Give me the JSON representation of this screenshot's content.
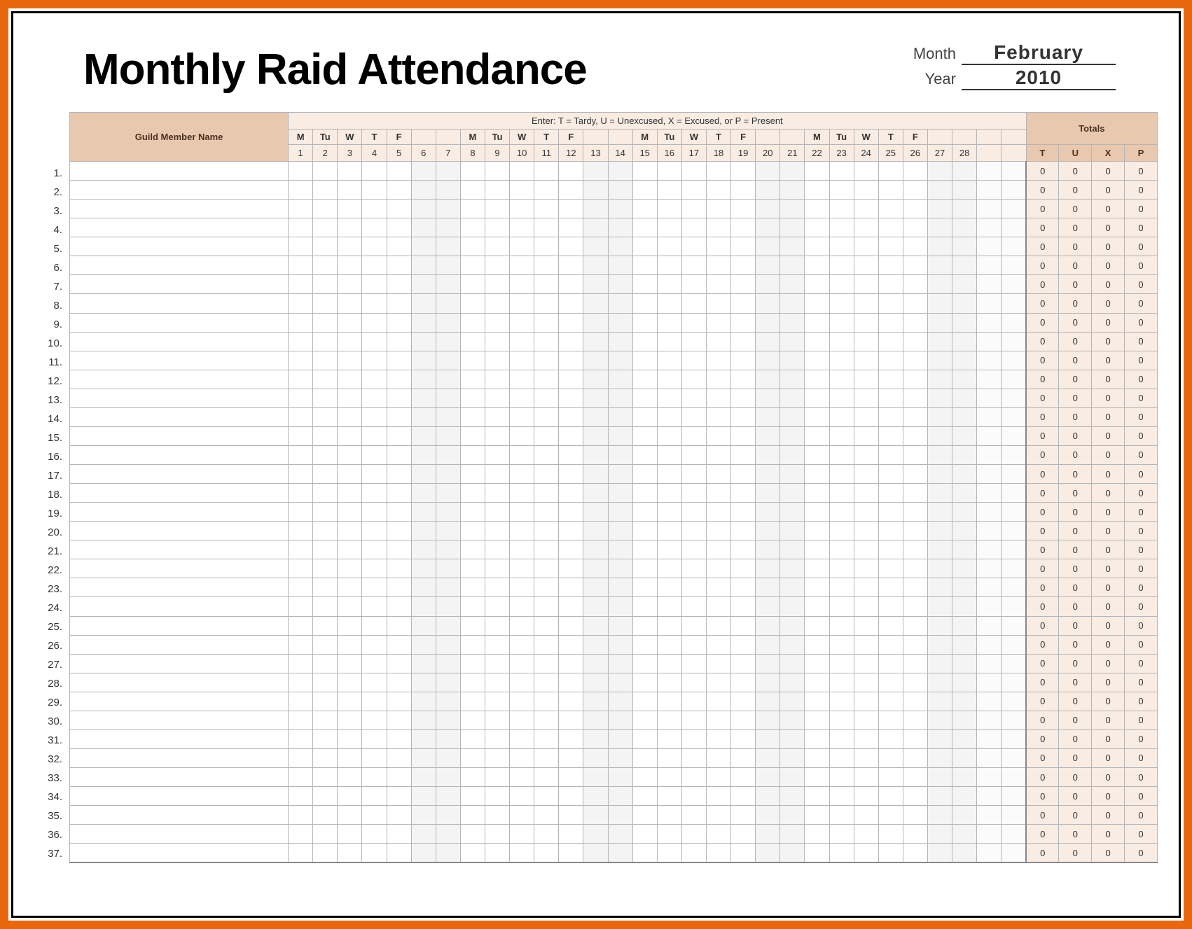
{
  "title": "Monthly Raid Attendance",
  "month_label": "Month",
  "year_label": "Year",
  "month_value": "February",
  "year_value": "2010",
  "name_header": "Guild Member Name",
  "legend": "Enter: T = Tardy,  U = Unexcused,  X = Excused,  or P = Present",
  "totals_header": "Totals",
  "total_codes": [
    "T",
    "U",
    "X",
    "P"
  ],
  "days": [
    {
      "n": 1,
      "dow": "M",
      "weekend": false
    },
    {
      "n": 2,
      "dow": "Tu",
      "weekend": false
    },
    {
      "n": 3,
      "dow": "W",
      "weekend": false
    },
    {
      "n": 4,
      "dow": "T",
      "weekend": false
    },
    {
      "n": 5,
      "dow": "F",
      "weekend": false
    },
    {
      "n": 6,
      "dow": "",
      "weekend": true
    },
    {
      "n": 7,
      "dow": "",
      "weekend": true
    },
    {
      "n": 8,
      "dow": "M",
      "weekend": false
    },
    {
      "n": 9,
      "dow": "Tu",
      "weekend": false
    },
    {
      "n": 10,
      "dow": "W",
      "weekend": false
    },
    {
      "n": 11,
      "dow": "T",
      "weekend": false
    },
    {
      "n": 12,
      "dow": "F",
      "weekend": false
    },
    {
      "n": 13,
      "dow": "",
      "weekend": true
    },
    {
      "n": 14,
      "dow": "",
      "weekend": true
    },
    {
      "n": 15,
      "dow": "M",
      "weekend": false
    },
    {
      "n": 16,
      "dow": "Tu",
      "weekend": false
    },
    {
      "n": 17,
      "dow": "W",
      "weekend": false
    },
    {
      "n": 18,
      "dow": "T",
      "weekend": false
    },
    {
      "n": 19,
      "dow": "F",
      "weekend": false
    },
    {
      "n": 20,
      "dow": "",
      "weekend": true
    },
    {
      "n": 21,
      "dow": "",
      "weekend": true
    },
    {
      "n": 22,
      "dow": "M",
      "weekend": false
    },
    {
      "n": 23,
      "dow": "Tu",
      "weekend": false
    },
    {
      "n": 24,
      "dow": "W",
      "weekend": false
    },
    {
      "n": 25,
      "dow": "T",
      "weekend": false
    },
    {
      "n": 26,
      "dow": "F",
      "weekend": false
    },
    {
      "n": 27,
      "dow": "",
      "weekend": true
    },
    {
      "n": 28,
      "dow": "",
      "weekend": true
    }
  ],
  "overflow_cols": 2,
  "rows": [
    {
      "num": "1.",
      "name": "",
      "marks": [],
      "totals": [
        0,
        0,
        0,
        0
      ]
    },
    {
      "num": "2.",
      "name": "",
      "marks": [],
      "totals": [
        0,
        0,
        0,
        0
      ]
    },
    {
      "num": "3.",
      "name": "",
      "marks": [],
      "totals": [
        0,
        0,
        0,
        0
      ]
    },
    {
      "num": "4.",
      "name": "",
      "marks": [],
      "totals": [
        0,
        0,
        0,
        0
      ]
    },
    {
      "num": "5.",
      "name": "",
      "marks": [],
      "totals": [
        0,
        0,
        0,
        0
      ]
    },
    {
      "num": "6.",
      "name": "",
      "marks": [],
      "totals": [
        0,
        0,
        0,
        0
      ]
    },
    {
      "num": "7.",
      "name": "",
      "marks": [],
      "totals": [
        0,
        0,
        0,
        0
      ]
    },
    {
      "num": "8.",
      "name": "",
      "marks": [],
      "totals": [
        0,
        0,
        0,
        0
      ]
    },
    {
      "num": "9.",
      "name": "",
      "marks": [],
      "totals": [
        0,
        0,
        0,
        0
      ]
    },
    {
      "num": "10.",
      "name": "",
      "marks": [],
      "totals": [
        0,
        0,
        0,
        0
      ]
    },
    {
      "num": "11.",
      "name": "",
      "marks": [],
      "totals": [
        0,
        0,
        0,
        0
      ]
    },
    {
      "num": "12.",
      "name": "",
      "marks": [],
      "totals": [
        0,
        0,
        0,
        0
      ]
    },
    {
      "num": "13.",
      "name": "",
      "marks": [],
      "totals": [
        0,
        0,
        0,
        0
      ]
    },
    {
      "num": "14.",
      "name": "",
      "marks": [],
      "totals": [
        0,
        0,
        0,
        0
      ]
    },
    {
      "num": "15.",
      "name": "",
      "marks": [],
      "totals": [
        0,
        0,
        0,
        0
      ]
    },
    {
      "num": "16.",
      "name": "",
      "marks": [],
      "totals": [
        0,
        0,
        0,
        0
      ]
    },
    {
      "num": "17.",
      "name": "",
      "marks": [],
      "totals": [
        0,
        0,
        0,
        0
      ]
    },
    {
      "num": "18.",
      "name": "",
      "marks": [],
      "totals": [
        0,
        0,
        0,
        0
      ]
    },
    {
      "num": "19.",
      "name": "",
      "marks": [],
      "totals": [
        0,
        0,
        0,
        0
      ]
    },
    {
      "num": "20.",
      "name": "",
      "marks": [],
      "totals": [
        0,
        0,
        0,
        0
      ]
    },
    {
      "num": "21.",
      "name": "",
      "marks": [],
      "totals": [
        0,
        0,
        0,
        0
      ]
    },
    {
      "num": "22.",
      "name": "",
      "marks": [],
      "totals": [
        0,
        0,
        0,
        0
      ]
    },
    {
      "num": "23.",
      "name": "",
      "marks": [],
      "totals": [
        0,
        0,
        0,
        0
      ]
    },
    {
      "num": "24.",
      "name": "",
      "marks": [],
      "totals": [
        0,
        0,
        0,
        0
      ]
    },
    {
      "num": "25.",
      "name": "",
      "marks": [],
      "totals": [
        0,
        0,
        0,
        0
      ]
    },
    {
      "num": "26.",
      "name": "",
      "marks": [],
      "totals": [
        0,
        0,
        0,
        0
      ]
    },
    {
      "num": "27.",
      "name": "",
      "marks": [],
      "totals": [
        0,
        0,
        0,
        0
      ]
    },
    {
      "num": "28.",
      "name": "",
      "marks": [],
      "totals": [
        0,
        0,
        0,
        0
      ]
    },
    {
      "num": "29.",
      "name": "",
      "marks": [],
      "totals": [
        0,
        0,
        0,
        0
      ]
    },
    {
      "num": "30.",
      "name": "",
      "marks": [],
      "totals": [
        0,
        0,
        0,
        0
      ]
    },
    {
      "num": "31.",
      "name": "",
      "marks": [],
      "totals": [
        0,
        0,
        0,
        0
      ]
    },
    {
      "num": "32.",
      "name": "",
      "marks": [],
      "totals": [
        0,
        0,
        0,
        0
      ]
    },
    {
      "num": "33.",
      "name": "",
      "marks": [],
      "totals": [
        0,
        0,
        0,
        0
      ]
    },
    {
      "num": "34.",
      "name": "",
      "marks": [],
      "totals": [
        0,
        0,
        0,
        0
      ]
    },
    {
      "num": "35.",
      "name": "",
      "marks": [],
      "totals": [
        0,
        0,
        0,
        0
      ]
    },
    {
      "num": "36.",
      "name": "",
      "marks": [],
      "totals": [
        0,
        0,
        0,
        0
      ]
    },
    {
      "num": "37.",
      "name": "",
      "marks": [],
      "totals": [
        0,
        0,
        0,
        0
      ]
    }
  ]
}
